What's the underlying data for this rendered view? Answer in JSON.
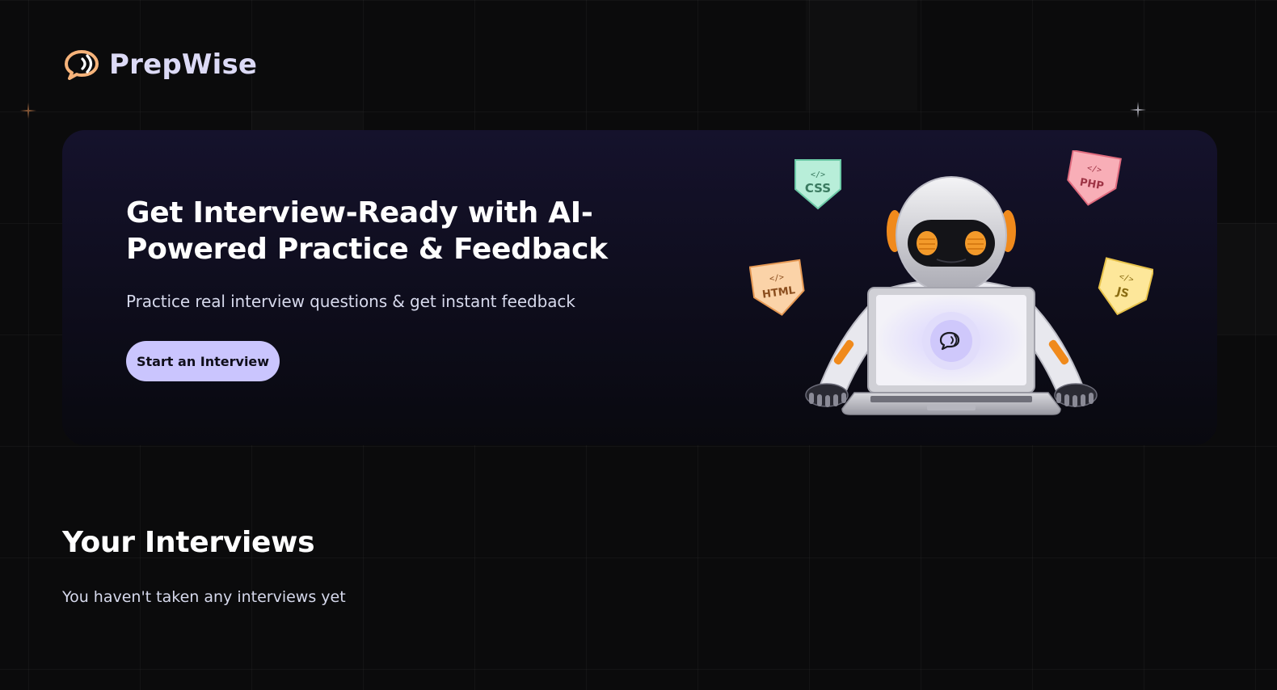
{
  "brand": {
    "name": "PrepWise"
  },
  "hero": {
    "title": "Get Interview-Ready with AI-Powered Practice & Feedback",
    "subtitle": "Practice real interview questions & get instant feedback",
    "cta_label": "Start an Interview",
    "tech_badges": [
      "CSS",
      "PHP",
      "HTML",
      "JS"
    ]
  },
  "interviews": {
    "title": "Your Interviews",
    "empty_message": "You haven't taken any interviews yet"
  },
  "colors": {
    "background": "#0b0b0c",
    "hero_background": "#15122c",
    "accent": "#cac5fe",
    "brand_text": "#dcdaf6",
    "logo_orange": "#f6b37a"
  },
  "icons": {
    "logo": "chat-bubble-icon",
    "decor": "sparkle-icon"
  }
}
